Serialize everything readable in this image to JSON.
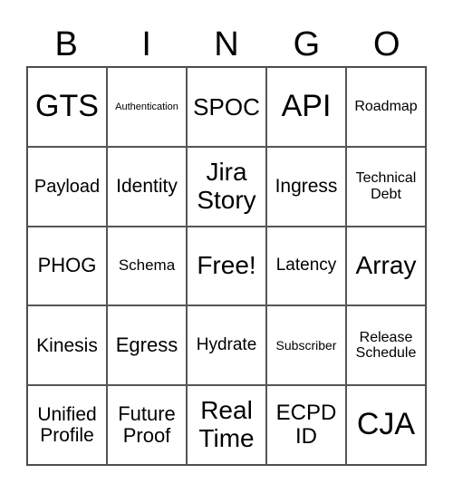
{
  "header": [
    "B",
    "I",
    "N",
    "G",
    "O"
  ],
  "cells": [
    {
      "text": "GTS",
      "size": "s34"
    },
    {
      "text": "Authentication",
      "size": "s11"
    },
    {
      "text": "SPOC",
      "size": "s26"
    },
    {
      "text": "API",
      "size": "s34"
    },
    {
      "text": "Roadmap",
      "size": "s16"
    },
    {
      "text": "Payload",
      "size": "s20"
    },
    {
      "text": "Identity",
      "size": "s21"
    },
    {
      "text": "Jira Story",
      "size": "s28"
    },
    {
      "text": "Ingress",
      "size": "s21"
    },
    {
      "text": "Technical Debt",
      "size": "s16"
    },
    {
      "text": "PHOG",
      "size": "s22"
    },
    {
      "text": "Schema",
      "size": "s17"
    },
    {
      "text": "Free!",
      "size": "s28"
    },
    {
      "text": "Latency",
      "size": "s19"
    },
    {
      "text": "Array",
      "size": "s28"
    },
    {
      "text": "Kinesis",
      "size": "s21"
    },
    {
      "text": "Egress",
      "size": "s22"
    },
    {
      "text": "Hydrate",
      "size": "s19"
    },
    {
      "text": "Subscriber",
      "size": "s14"
    },
    {
      "text": "Release Schedule",
      "size": "s16"
    },
    {
      "text": "Unified Profile",
      "size": "s21"
    },
    {
      "text": "Future Proof",
      "size": "s22"
    },
    {
      "text": "Real Time",
      "size": "s28"
    },
    {
      "text": "ECPD ID",
      "size": "s24"
    },
    {
      "text": "CJA",
      "size": "s34"
    }
  ]
}
